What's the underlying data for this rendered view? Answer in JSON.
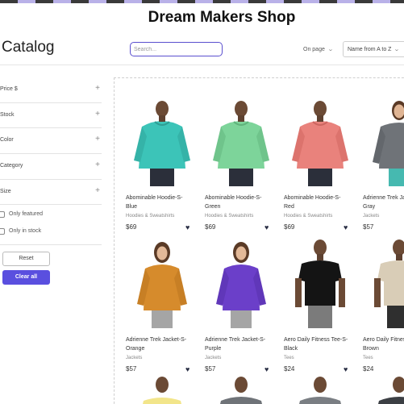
{
  "shop": {
    "title": "Dream Makers Shop"
  },
  "catalog": {
    "title": "Catalog"
  },
  "search": {
    "placeholder": "Search..."
  },
  "toolbar": {
    "per_page": "On page",
    "sort": "Name from A to Z"
  },
  "filters": [
    {
      "label": "Price $"
    },
    {
      "label": "Stock"
    },
    {
      "label": "Color"
    },
    {
      "label": "Category"
    },
    {
      "label": "Size"
    }
  ],
  "checks": [
    {
      "label": "Only featured"
    },
    {
      "label": "Only in stock"
    }
  ],
  "buttons": {
    "reset": "Reset",
    "clear": "Clear all"
  },
  "products": [
    {
      "name": "Abominable Hoodie-S-Blue",
      "category": "Hoodies & Sweatshirts",
      "price": "$69"
    },
    {
      "name": "Abominable Hoodie-S-Green",
      "category": "Hoodies & Sweatshirts",
      "price": "$69"
    },
    {
      "name": "Abominable Hoodie-S-Red",
      "category": "Hoodies & Sweatshirts",
      "price": "$69"
    },
    {
      "name": "Adrienne Trek Jacket-S-Gray",
      "category": "Jackets",
      "price": "$57"
    },
    {
      "name": "Adrienne Trek Jacket-S-Orange",
      "category": "Jackets",
      "price": "$57"
    },
    {
      "name": "Adrienne Trek Jacket-S-Purple",
      "category": "Jackets",
      "price": "$57"
    },
    {
      "name": "Aero Daily Fitness Tee-S-Black",
      "category": "Tees",
      "price": "$24"
    },
    {
      "name": "Aero Daily Fitness Tee-S-Brown",
      "category": "Tees",
      "price": "$24"
    }
  ],
  "colors": {
    "accent": "#5a4fdf",
    "heart": "#2a2f45"
  }
}
